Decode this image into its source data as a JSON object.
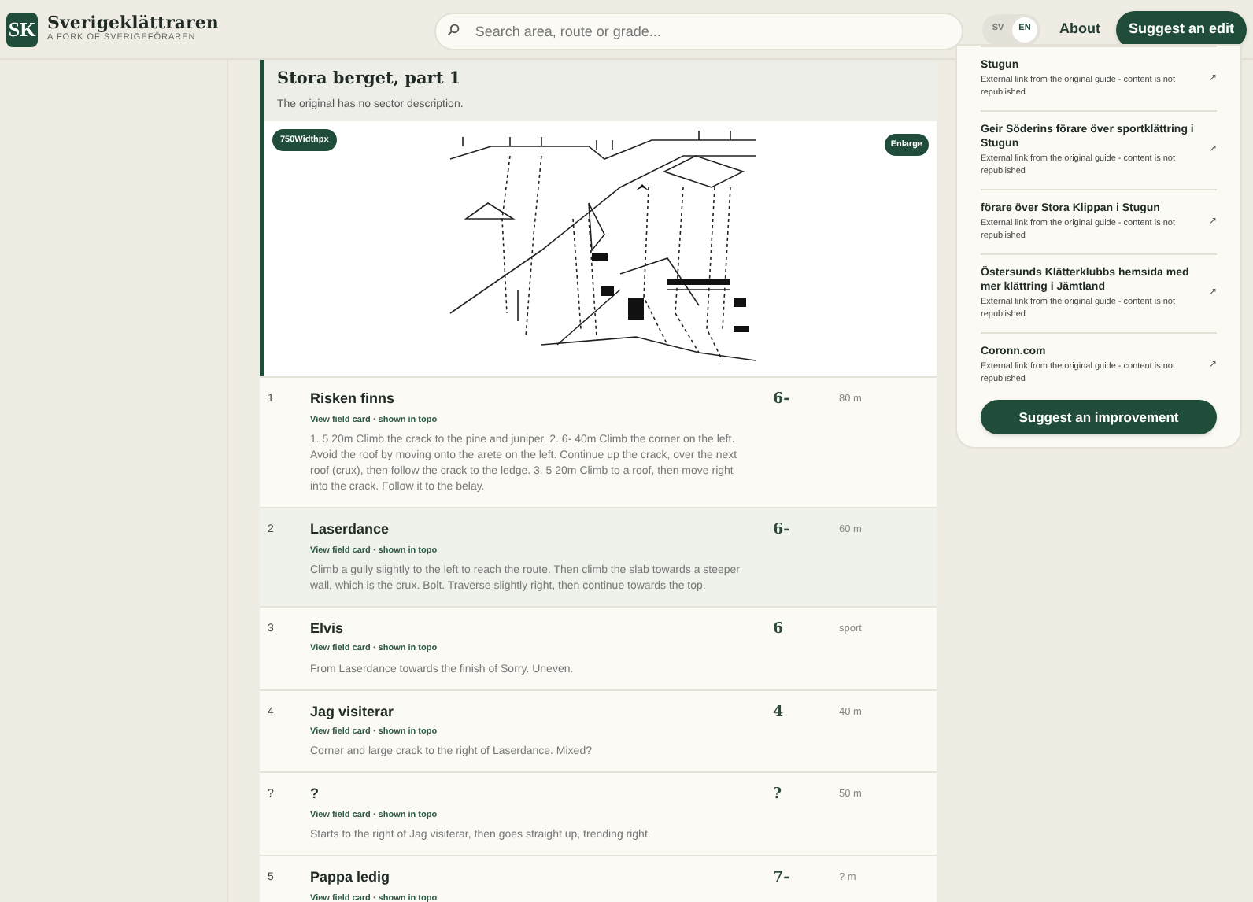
{
  "header": {
    "logo_mark": "SK",
    "site_name": "Sverigeklättraren",
    "tagline": "A FORK OF SVERIGEFÖRAREN",
    "search": {
      "placeholder": "Search area, route or grade..."
    },
    "languages": [
      {
        "label": "SV",
        "selected": false
      },
      {
        "label": "EN",
        "selected": true
      }
    ],
    "nav_link": "About",
    "action_button": "Suggest an edit"
  },
  "sector": {
    "title": "Stora berget, part 1",
    "description": "The original has no sector description.",
    "topo_badge": "750Widthpx",
    "enlarge_button": "Enlarge"
  },
  "routes": [
    {
      "number": "1",
      "name": "Risken finns",
      "links": "View field card · shown in topo",
      "description": "1. 5 20m Climb the crack to the pine and juniper. 2. 6- 40m Climb the corner on the left. Avoid the roof by moving onto the arete on the left. Continue up the crack, over the next roof (crux), then follow the crack to the ledge. 3. 5 20m Climb to a roof, then move right into the crack. Follow it to the belay.",
      "grade": "6-",
      "length": "80 m",
      "selected": false
    },
    {
      "number": "2",
      "name": "Laserdance",
      "links": "View field card · shown in topo",
      "description": "Climb a gully slightly to the left to reach the route. Then climb the slab towards a steeper wall, which is the crux. Bolt. Traverse slightly right, then continue towards the top.",
      "grade": "6-",
      "length": "60 m",
      "selected": true
    },
    {
      "number": "3",
      "name": "Elvis",
      "links": "View field card · shown in topo",
      "description": "From Laserdance towards the finish of Sorry. Uneven.",
      "grade": "6",
      "length": "sport",
      "selected": false
    },
    {
      "number": "4",
      "name": "Jag visiterar",
      "links": "View field card · shown in topo",
      "description": "Corner and large crack to the right of Laserdance. Mixed?",
      "grade": "4",
      "length": "40 m",
      "selected": false
    },
    {
      "number": "?",
      "name": "?",
      "links": "View field card · shown in topo",
      "description": "Starts to the right of Jag visiterar, then goes straight up, trending right.",
      "grade": "?",
      "length": "50 m",
      "selected": false
    },
    {
      "number": "5",
      "name": "Pappa ledig",
      "links": "View field card · shown in topo",
      "grade": "7-",
      "length": "? m",
      "selected": false
    }
  ],
  "external_links": [
    {
      "title": "Stugun",
      "note": "External link from the original guide - content is not republished",
      "icon": "↗"
    },
    {
      "title": "Geir Söderins förare över sportklättring i Stugun",
      "note": "External link from the original guide - content is not republished",
      "icon": "↗"
    },
    {
      "title": "förare över Stora Klippan i Stugun",
      "note": "External link from the original guide - content is not republished",
      "icon": "↗"
    },
    {
      "title": "Östersunds Klätterklubbs hemsida med mer klättring i Jämtland",
      "note": "External link from the original guide - content is not republished",
      "icon": "↗"
    },
    {
      "title": "Coronn.com",
      "note": "External link from the original guide - content is not republished",
      "icon": "↗"
    }
  ],
  "improve_button": "Suggest an improvement"
}
